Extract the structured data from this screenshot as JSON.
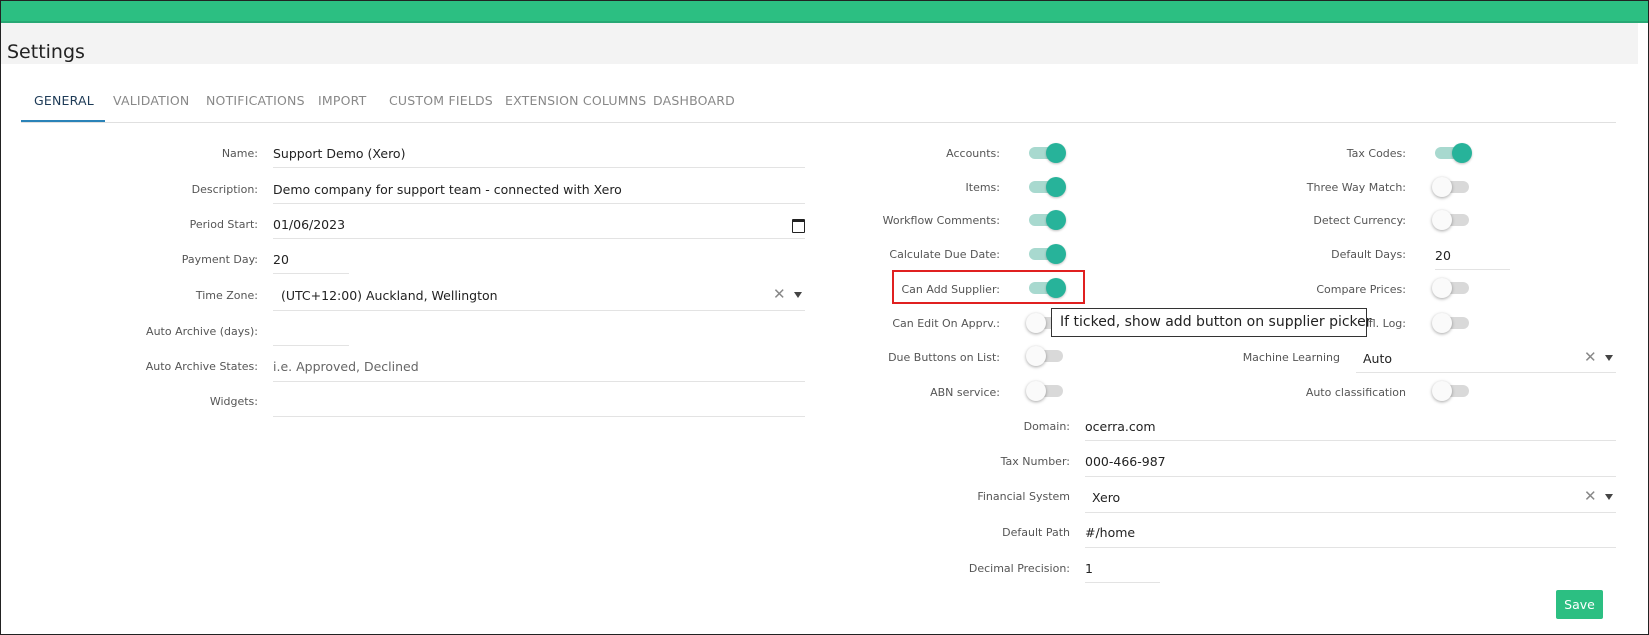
{
  "header": {
    "title": "Settings"
  },
  "tabs": [
    "GENERAL",
    "VALIDATION",
    "NOTIFICATIONS",
    "IMPORT",
    "CUSTOM FIELDS",
    "EXTENSION COLUMNS",
    "DASHBOARD"
  ],
  "general": {
    "name_label": "Name:",
    "name_value": "Support Demo (Xero)",
    "description_label": "Description:",
    "description_value": "Demo company for support team - connected with Xero",
    "period_start_label": "Period Start:",
    "period_start_value": "01/06/2023",
    "payment_day_label": "Payment Day:",
    "payment_day_value": "20",
    "time_zone_label": "Time Zone:",
    "time_zone_value": "(UTC+12:00) Auckland, Wellington",
    "auto_archive_days_label": "Auto Archive (days):",
    "auto_archive_days_value": "",
    "auto_archive_states_label": "Auto Archive States:",
    "auto_archive_states_placeholder": "i.e. Approved, Declined",
    "widgets_label": "Widgets:",
    "widgets_value": ""
  },
  "toggles_left": {
    "accounts": {
      "label": "Accounts:",
      "on": true
    },
    "items": {
      "label": "Items:",
      "on": true
    },
    "workflow_comments": {
      "label": "Workflow Comments:",
      "on": true
    },
    "calculate_due_date": {
      "label": "Calculate Due Date:",
      "on": true
    },
    "can_add_supplier": {
      "label": "Can Add Supplier:",
      "on": true
    },
    "can_edit_on_apprv": {
      "label": "Can Edit On Apprv.:",
      "on": false
    },
    "due_buttons_on_list": {
      "label": "Due Buttons on List:",
      "on": false
    },
    "abn_service": {
      "label": "ABN service:",
      "on": false
    }
  },
  "toggles_right": {
    "tax_codes": {
      "label": "Tax Codes:",
      "on": true
    },
    "three_way_match": {
      "label": "Three Way Match:",
      "on": false
    },
    "detect_currency": {
      "label": "Detect Currency:",
      "on": false
    },
    "default_days": {
      "label": "Default Days:",
      "value": "20"
    },
    "compare_prices": {
      "label": "Compare Prices:",
      "on": false
    },
    "wkfl_log": {
      "label": "kfl. Log:",
      "on": false
    },
    "machine_learning": {
      "label": "Machine Learning",
      "value": "Auto"
    },
    "auto_classification": {
      "label": "Auto classification",
      "on": false
    }
  },
  "lower": {
    "domain_label": "Domain:",
    "domain_value": "ocerra.com",
    "tax_number_label": "Tax Number:",
    "tax_number_value": "000-466-987",
    "financial_system_label": "Financial System",
    "financial_system_value": "Xero",
    "default_path_label": "Default Path",
    "default_path_value": "#/home",
    "decimal_precision_label": "Decimal Precision:",
    "decimal_precision_value": "1"
  },
  "tooltip": {
    "text": "If ticked, show add button on supplier picker"
  },
  "actions": {
    "save_label": "Save"
  },
  "colors": {
    "accent": "#2cbf82",
    "toggle_on": "#27b39a",
    "tab_ink": "#2a83b8",
    "highlight": "#e02020"
  },
  "icons": {
    "clear": "close-icon",
    "dropdown": "caret-down-icon",
    "calendar": "calendar-icon"
  }
}
